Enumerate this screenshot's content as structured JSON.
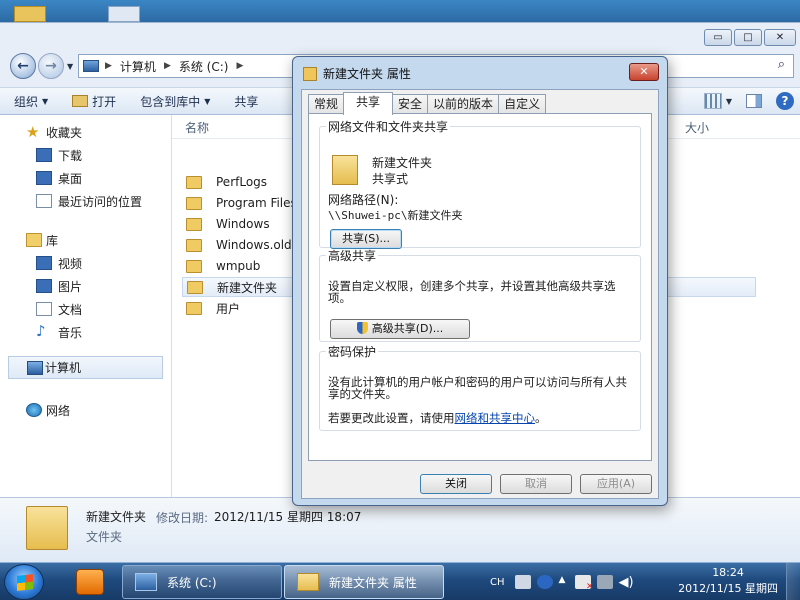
{
  "explorer": {
    "caption_buttons": {
      "minimize": "▭",
      "maximize": "□",
      "close": "✕"
    },
    "breadcrumb": [
      "计算机",
      "系统 (C:)"
    ],
    "toolbar": {
      "organize": "组织",
      "open": "打开",
      "include_library": "包含到库中",
      "share": "共享"
    },
    "sidebar": {
      "favorites": {
        "label": "收藏夹",
        "items": [
          "下载",
          "桌面",
          "最近访问的位置"
        ]
      },
      "libraries": {
        "label": "库",
        "items": [
          "视频",
          "图片",
          "文档",
          "音乐"
        ]
      },
      "computer": "计算机",
      "network": "网络"
    },
    "columns": {
      "name": "名称",
      "size": "大小"
    },
    "files": [
      "PerfLogs",
      "Program Files",
      "Windows",
      "Windows.old",
      "wmpub",
      "新建文件夹",
      "用户"
    ],
    "selected_file": "新建文件夹",
    "details": {
      "name": "新建文件夹",
      "modified_label": "修改日期:",
      "modified_value": "2012/11/15 星期四 18:07",
      "type": "文件夹"
    }
  },
  "dialog": {
    "title": "新建文件夹 属性",
    "close": "✕",
    "tabs": [
      "常规",
      "共享",
      "安全",
      "以前的版本",
      "自定义"
    ],
    "active_tab": "共享",
    "network_sharing": {
      "legend": "网络文件和文件夹共享",
      "folder_name": "新建文件夹",
      "state": "共享式",
      "path_label": "网络路径(N):",
      "path": "\\\\Shuwei-pc\\新建文件夹",
      "share_button": "共享(S)..."
    },
    "advanced_sharing": {
      "legend": "高级共享",
      "description": "设置自定义权限，创建多个共享，并设置其他高级共享选项。",
      "button": "高级共享(D)..."
    },
    "password": {
      "legend": "密码保护",
      "description": "没有此计算机的用户帐户和密码的用户可以访问与所有人共享的文件夹。",
      "change_prefix": "若要更改此设置，请使用",
      "link": "网络和共享中心",
      "change_suffix": "。"
    },
    "buttons": {
      "ok": "关闭",
      "cancel": "取消",
      "apply": "应用(A)"
    }
  },
  "taskbar": {
    "tasks": [
      "系统 (C:)",
      "新建文件夹 属性"
    ],
    "ime": "CH",
    "time": "18:24",
    "date": "2012/11/15 星期四"
  }
}
